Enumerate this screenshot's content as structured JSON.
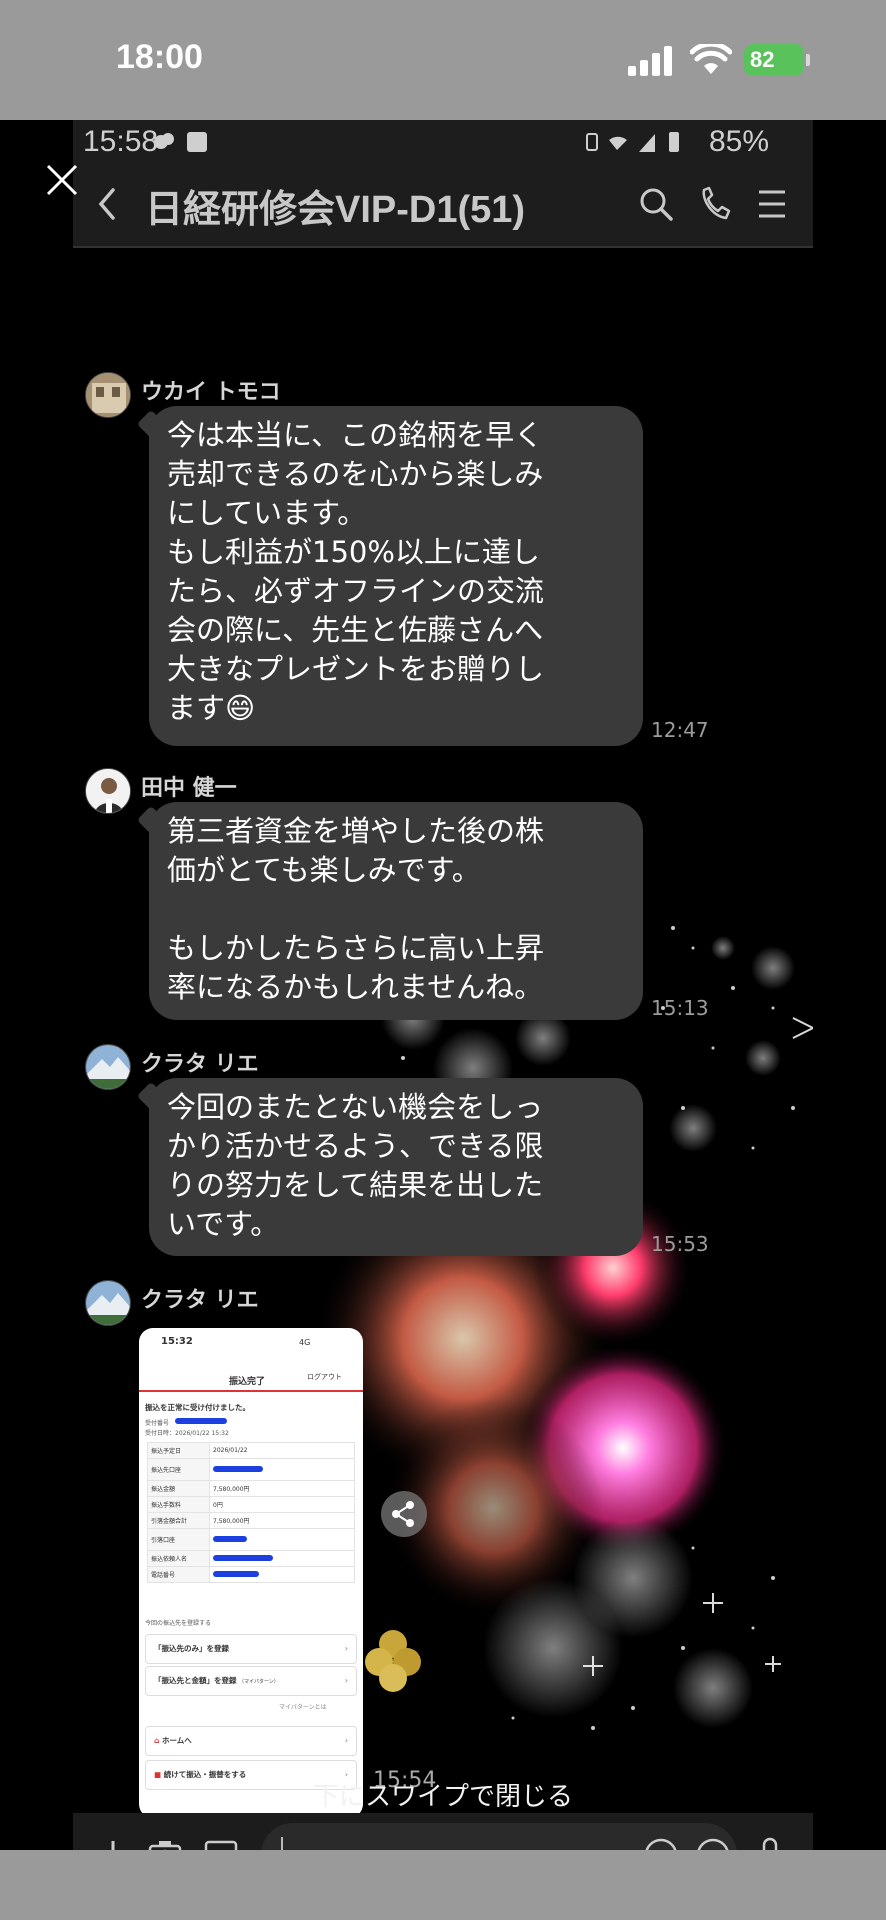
{
  "ios_status": {
    "time": "18:00",
    "battery": "82"
  },
  "inner_status": {
    "time": "15:58",
    "battery": "85%"
  },
  "chat_header": {
    "title": "日経研修会VIP-D1(51)"
  },
  "messages": [
    {
      "sender": "ウカイ トモコ",
      "lines": [
        "今は本当に、この銘柄を早く",
        "売却できるのを心から楽しみ",
        "にしています。",
        "もし利益が150%以上に達し",
        "たら、必ずオフラインの交流",
        "会の際に、先生と佐藤さんへ",
        "大きなプレゼントをお贈りし",
        "ます😄"
      ],
      "time": "12:47"
    },
    {
      "sender": "田中 健一",
      "lines": [
        "第三者資金を増やした後の株",
        "価がとても楽しみです。",
        "",
        "もしかしたらさらに高い上昇",
        "率になるかもしれませんね。"
      ],
      "time": "15:13"
    },
    {
      "sender": "クラタ リエ",
      "lines": [
        "今回のまたとない機会をしっ",
        "かり活かせるよう、できる限",
        "りの努力をして結果を出した",
        "いです。"
      ],
      "time": "15:53"
    },
    {
      "sender": "クラタ リエ",
      "time": "15:54"
    }
  ],
  "receipt": {
    "time": "15:32",
    "signal": "4G",
    "title": "振込完了",
    "logout": "ログアウト",
    "done_text": "振込を正常に受け付けました。",
    "accept_no_label": "受付番号",
    "accept_date": "受付日時：2026/01/22 15:32",
    "rows": [
      {
        "k": "振込予定日",
        "v": "2026/01/22"
      },
      {
        "k": "振込先口座",
        "v": ""
      },
      {
        "k": "振込金額",
        "v": "7,580,000円"
      },
      {
        "k": "振込手数料",
        "v": "0円"
      },
      {
        "k": "引落金額合計",
        "v": "7,580,000円"
      },
      {
        "k": "引落口座",
        "v": ""
      },
      {
        "k": "振込依頼人名",
        "v": ""
      },
      {
        "k": "電話番号",
        "v": ""
      }
    ],
    "register_heading": "今回の振込先を登録する",
    "btn_payee_only": "「振込先のみ」を登録",
    "btn_payee_amount": "「振込先と金額」を登録",
    "btn_payee_amount_sub": "（マイパターン）",
    "mypattern_link": "マイパターンとは",
    "btn_home": "ホームへ",
    "btn_continue": "続けて振込・振替をする"
  },
  "swipe_hint": "下にスワイプで閉じる",
  "colors": {
    "bubble": "#3a3a3a",
    "battery_green": "#59c25b",
    "redaction_blue": "#1c3fe0"
  }
}
